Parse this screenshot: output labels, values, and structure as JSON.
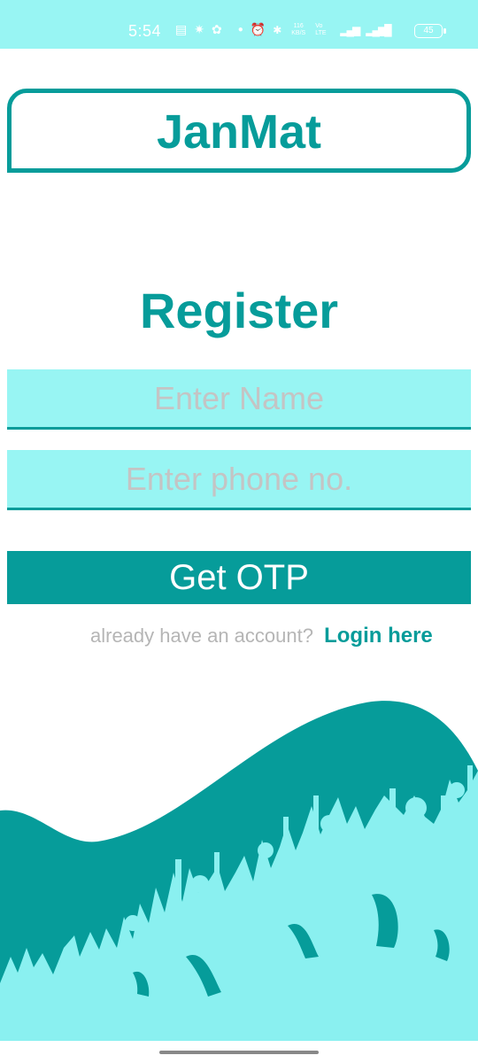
{
  "status_bar": {
    "time": "5:54",
    "net_speed": "116 KB/S",
    "battery": "45",
    "icons": [
      "notes-icon",
      "app-icon",
      "twitter-icon",
      "dot-icon",
      "alarm-icon",
      "bluetooth-icon",
      "speed-icon",
      "volte-icon",
      "signal-4g-icon",
      "signal-icon",
      "battery-icon"
    ]
  },
  "app": {
    "brand": "JanMat",
    "page_title": "Register"
  },
  "form": {
    "name_placeholder": "Enter Name",
    "phone_placeholder": "Enter phone no.",
    "submit_label": "Get OTP"
  },
  "login": {
    "prompt": "already have an account?",
    "link": "Login here"
  },
  "colors": {
    "primary": "#069c9a",
    "light": "#98f5f3",
    "crowd": "#8af0f0",
    "placeholder": "#c4c4c4"
  }
}
